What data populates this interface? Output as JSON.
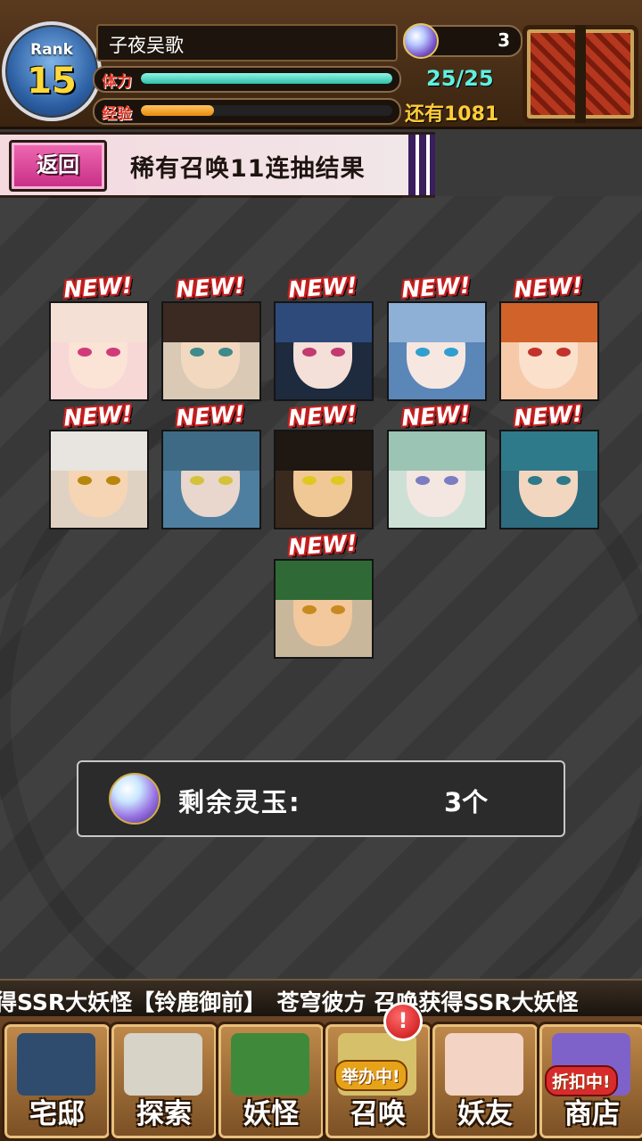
{
  "header": {
    "rank_label": "Rank",
    "rank_value": "15",
    "player_name": "子夜吴歌",
    "stamina_label": "体力",
    "stamina_value": "25/25",
    "stamina_fill": 1.0,
    "exp_label": "经验",
    "exp_fill": 0.29,
    "exp_remaining": "还有1081",
    "orb_count": "3"
  },
  "title_bar": {
    "back_label": "返回",
    "title": "稀有召唤11连抽结果"
  },
  "results": {
    "new_label": "NEW!",
    "cards": [
      {
        "hair": "#f4e0d4",
        "skin": "#fbe3d6",
        "eye": "#d13a7a",
        "bg": "#f8d7d7"
      },
      {
        "hair": "#3b2a22",
        "skin": "#f3d8c0",
        "eye": "#3f8a8a",
        "bg": "#d9c9b5"
      },
      {
        "hair": "#2d4a7a",
        "skin": "#f4e0d8",
        "eye": "#c23a6e",
        "bg": "#1e2a3e"
      },
      {
        "hair": "#8fb0d6",
        "skin": "#f7e7e1",
        "eye": "#2f9fd0",
        "bg": "#5b86b8"
      },
      {
        "hair": "#d0622a",
        "skin": "#fbe0cc",
        "eye": "#c2322a",
        "bg": "#f6c9a8"
      },
      {
        "hair": "#e8e4df",
        "skin": "#f6d5b5",
        "eye": "#b8860b",
        "bg": "#e0d2c2"
      },
      {
        "hair": "#3e6a86",
        "skin": "#e9d6cc",
        "eye": "#d4c23a",
        "bg": "#4e7fa0"
      },
      {
        "hair": "#1f1712",
        "skin": "#f0c896",
        "eye": "#e0c820",
        "bg": "#3a2a1e"
      },
      {
        "hair": "#9bc4b4",
        "skin": "#f4e6e0",
        "eye": "#7c7cc2",
        "bg": "#cde0d6"
      },
      {
        "hair": "#2f7a8a",
        "skin": "#f2d6c0",
        "eye": "#2f7a8a",
        "bg": "#2d6b7e"
      },
      {
        "hair": "#2f6a36",
        "skin": "#f2c89c",
        "eye": "#c88a20",
        "bg": "#c9b79c"
      }
    ]
  },
  "remaining": {
    "label": "剩余灵玉:",
    "value": "3个"
  },
  "ticker": {
    "text": "得SSR大妖怪【铃鹿御前】　苍穹彼方 召唤获得SSR大妖怪"
  },
  "nav": {
    "items": [
      {
        "label": "宅邸",
        "art": "#2f4b6e"
      },
      {
        "label": "探索",
        "art": "#d7d3c6"
      },
      {
        "label": "妖怪",
        "art": "#3f8a3a"
      },
      {
        "label": "召唤",
        "art": "#d7c06a",
        "badge": "举办中!"
      },
      {
        "label": "妖友",
        "art": "#f3d3c3"
      },
      {
        "label": "商店",
        "art": "#7f62c9",
        "badge": "折扣中!"
      }
    ],
    "alert": "!"
  }
}
